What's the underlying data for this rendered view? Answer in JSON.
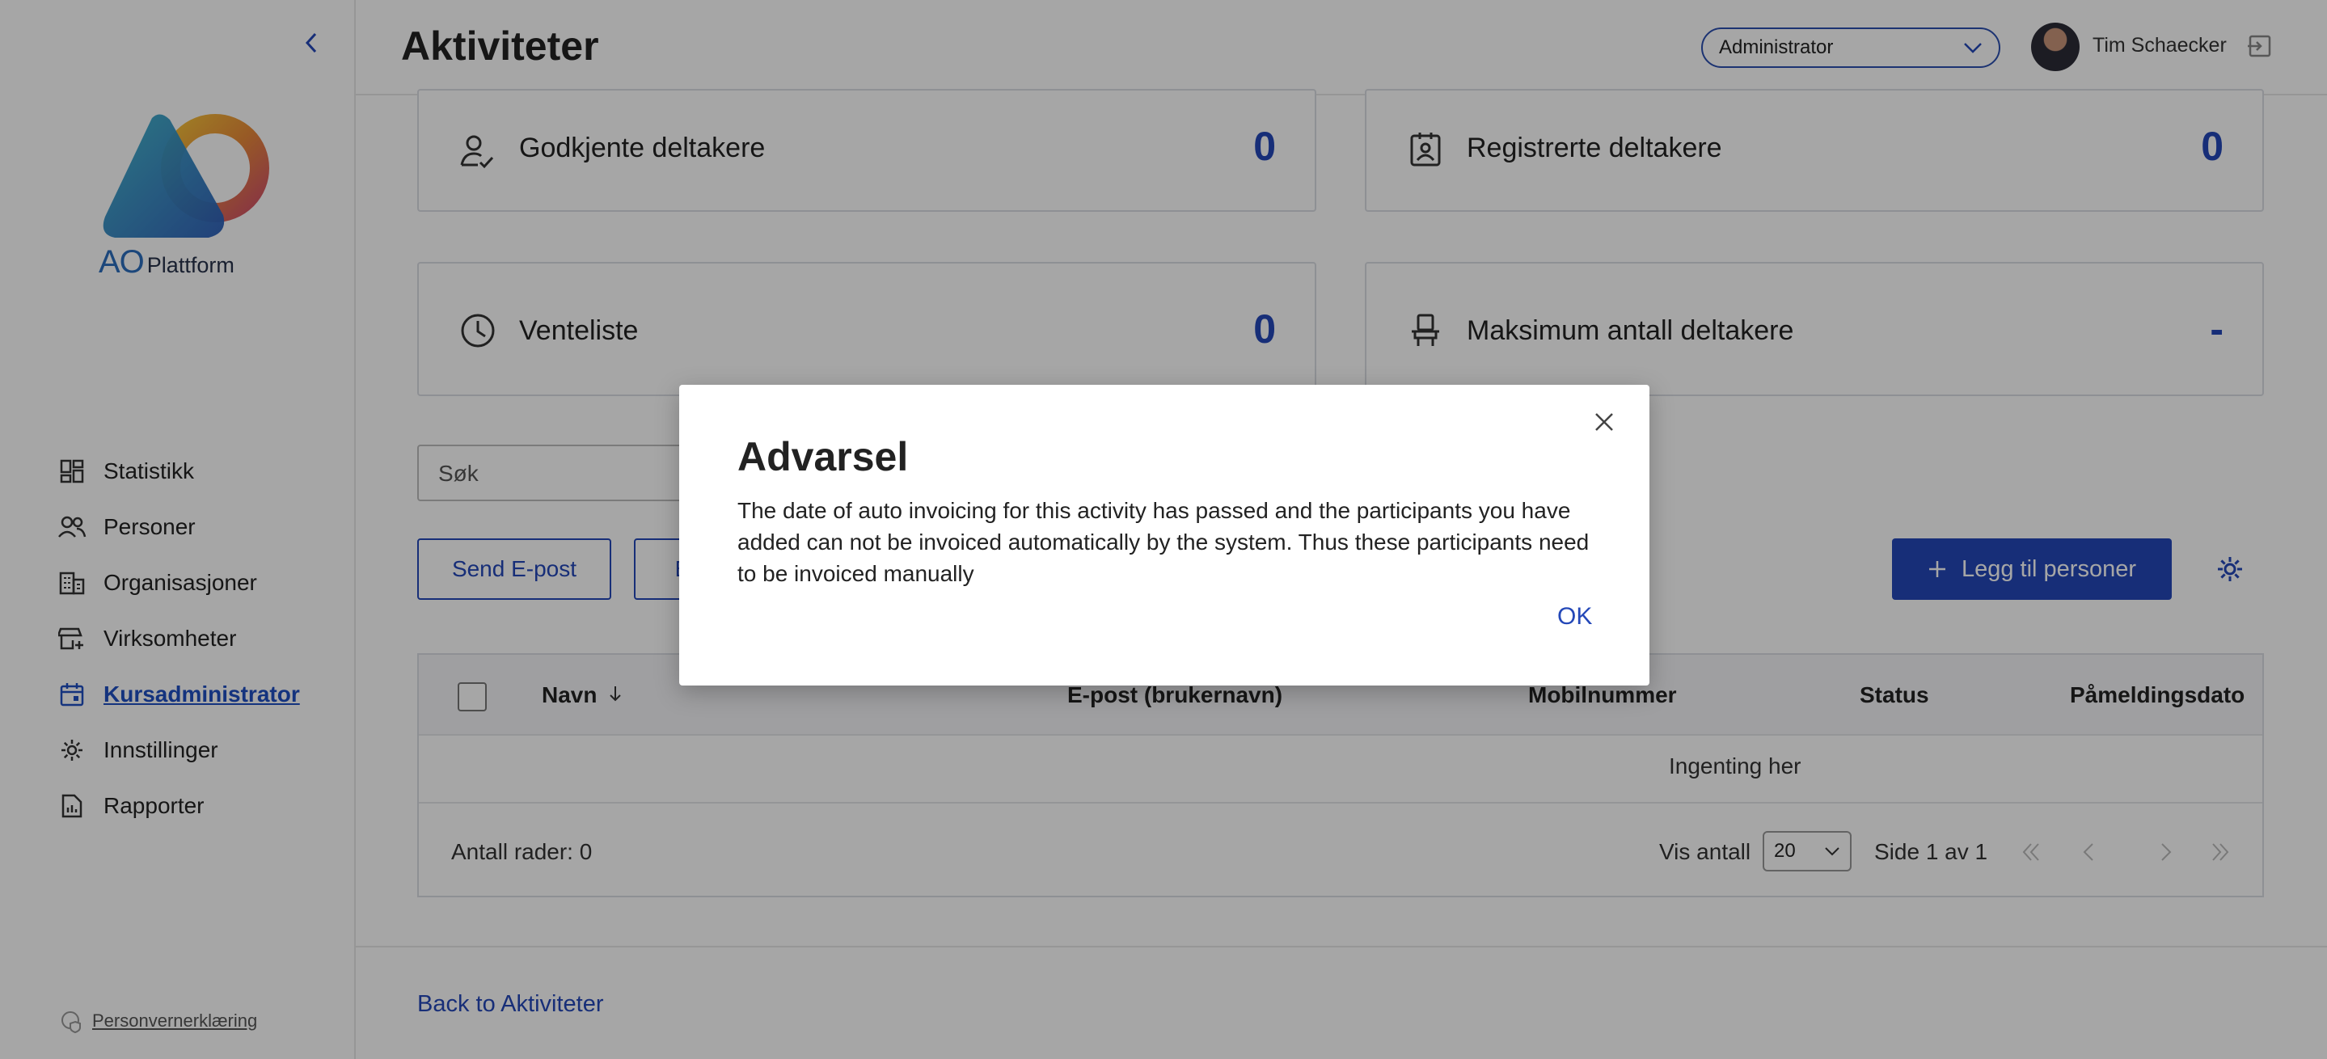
{
  "sidebar": {
    "logo": {
      "brand": "AO",
      "product": "Plattform"
    },
    "items": [
      {
        "label": "Statistikk",
        "icon": "dashboard-icon",
        "active": false
      },
      {
        "label": "Personer",
        "icon": "people-icon",
        "active": false
      },
      {
        "label": "Organisasjoner",
        "icon": "building-icon",
        "active": false
      },
      {
        "label": "Virksomheter",
        "icon": "store-icon",
        "active": false
      },
      {
        "label": "Kursadministrator",
        "icon": "calendar-icon",
        "active": true
      },
      {
        "label": "Innstillinger",
        "icon": "gear-icon",
        "active": false
      },
      {
        "label": "Rapporter",
        "icon": "report-icon",
        "active": false
      }
    ],
    "privacy_label": "Personvernerklæring"
  },
  "header": {
    "title": "Aktiviteter",
    "role": "Administrator",
    "user_name": "Tim Schaecker"
  },
  "stats": {
    "approved": {
      "label": "Godkjente deltakere",
      "value": "0"
    },
    "registered": {
      "label": "Registrerte deltakere",
      "value": "0"
    },
    "waitlist": {
      "label": "Venteliste",
      "value": "0"
    },
    "max": {
      "label": "Maksimum antall deltakere",
      "value": "-"
    }
  },
  "toolbar": {
    "search_placeholder": "Søk",
    "send_email": "Send E-post",
    "second_button": "E",
    "add_people": "Legg til personer"
  },
  "table": {
    "columns": [
      "Navn",
      "E-post (brukernavn)",
      "Mobilnummer",
      "Status",
      "Påmeldingsdato"
    ],
    "empty_text": "Ingenting her",
    "rows_count_label": "Antall rader: 0",
    "page_size_label": "Vis antall",
    "page_size": "20",
    "page_info": "Side 1 av 1"
  },
  "back_link": "Back to Aktiviteter",
  "dialog": {
    "title": "Advarsel",
    "body": "The date of auto invoicing for this activity has passed and the participants you have added can not be invoiced automatically by the system. Thus these participants need to be invoiced manually",
    "ok_label": "OK"
  },
  "colors": {
    "accent": "#2448b8",
    "overlay": "rgba(0,0,0,0.35)"
  }
}
